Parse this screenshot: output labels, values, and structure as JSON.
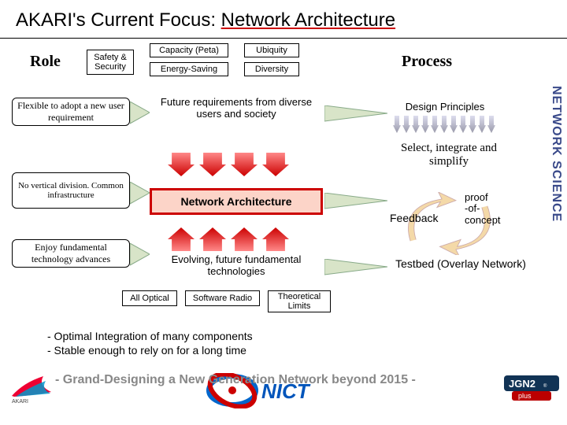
{
  "title_prefix": "AKARI's Current Focus: ",
  "title_underlined": "Network Architecture",
  "role_label": "Role",
  "process_label": "Process",
  "side_label": "NETWORK SCIENCE",
  "grid": {
    "safety": "Safety & Security",
    "capacity": "Capacity (Peta)",
    "ubiquity": "Ubiquity",
    "energy": "Energy-Saving",
    "diversity": "Diversity"
  },
  "roles": {
    "flexible": "Flexible to adopt a new user requirement",
    "novert": "No vertical division. Common infrastructure",
    "enjoy": "Enjoy  fundamental technology advances"
  },
  "mid": {
    "future": "Future requirements from diverse users and society",
    "netarch": "Network Architecture",
    "evolving": "Evolving, future fundamental technologies"
  },
  "techs": {
    "optical": "All Optical",
    "radio": "Software Radio",
    "limits": "Theoretical Limits"
  },
  "process": {
    "design": "Design Principles",
    "select": "Select, integrate and simplify",
    "feedback": "Feedback",
    "proof": "proof\n-of-\nconcept",
    "testbed": "Testbed (Overlay Network)"
  },
  "footer": {
    "l1": "- Optimal Integration of many components",
    "l2": "- Stable enough to rely on for a long time"
  },
  "grand": "- Grand-Designing a New Generation Network beyond 2015 -",
  "logos": {
    "akari": "AKARI",
    "nict": "NICT",
    "jgn": "JGN2 plus"
  }
}
